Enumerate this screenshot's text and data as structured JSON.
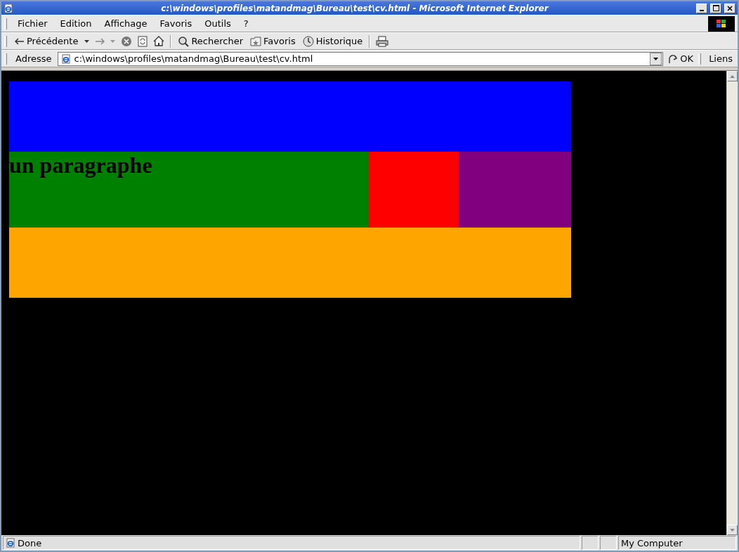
{
  "window": {
    "title": "c:\\windows\\profiles\\matandmag\\Bureau\\test\\cv.html - Microsoft Internet Explorer"
  },
  "menu": [
    "Fichier",
    "Edition",
    "Affichage",
    "Favoris",
    "Outils",
    "?"
  ],
  "toolbar": {
    "back": "Précédente",
    "search": "Rechercher",
    "favorites": "Favoris",
    "history": "Historique"
  },
  "address_bar": {
    "label": "Adresse",
    "value": "c:\\windows\\profiles\\matandmag\\Bureau\\test\\cv.html",
    "go": "OK",
    "links": "Liens"
  },
  "page": {
    "header": {
      "color": "#0000ff"
    },
    "middle": [
      {
        "color": "#008000",
        "text": "un paragraphe"
      },
      {
        "color": "#ff0000"
      },
      {
        "color": "#800080"
      }
    ],
    "footer": {
      "color": "#ffa500"
    }
  },
  "status_bar": {
    "text": "Done",
    "zone": "My Computer"
  }
}
